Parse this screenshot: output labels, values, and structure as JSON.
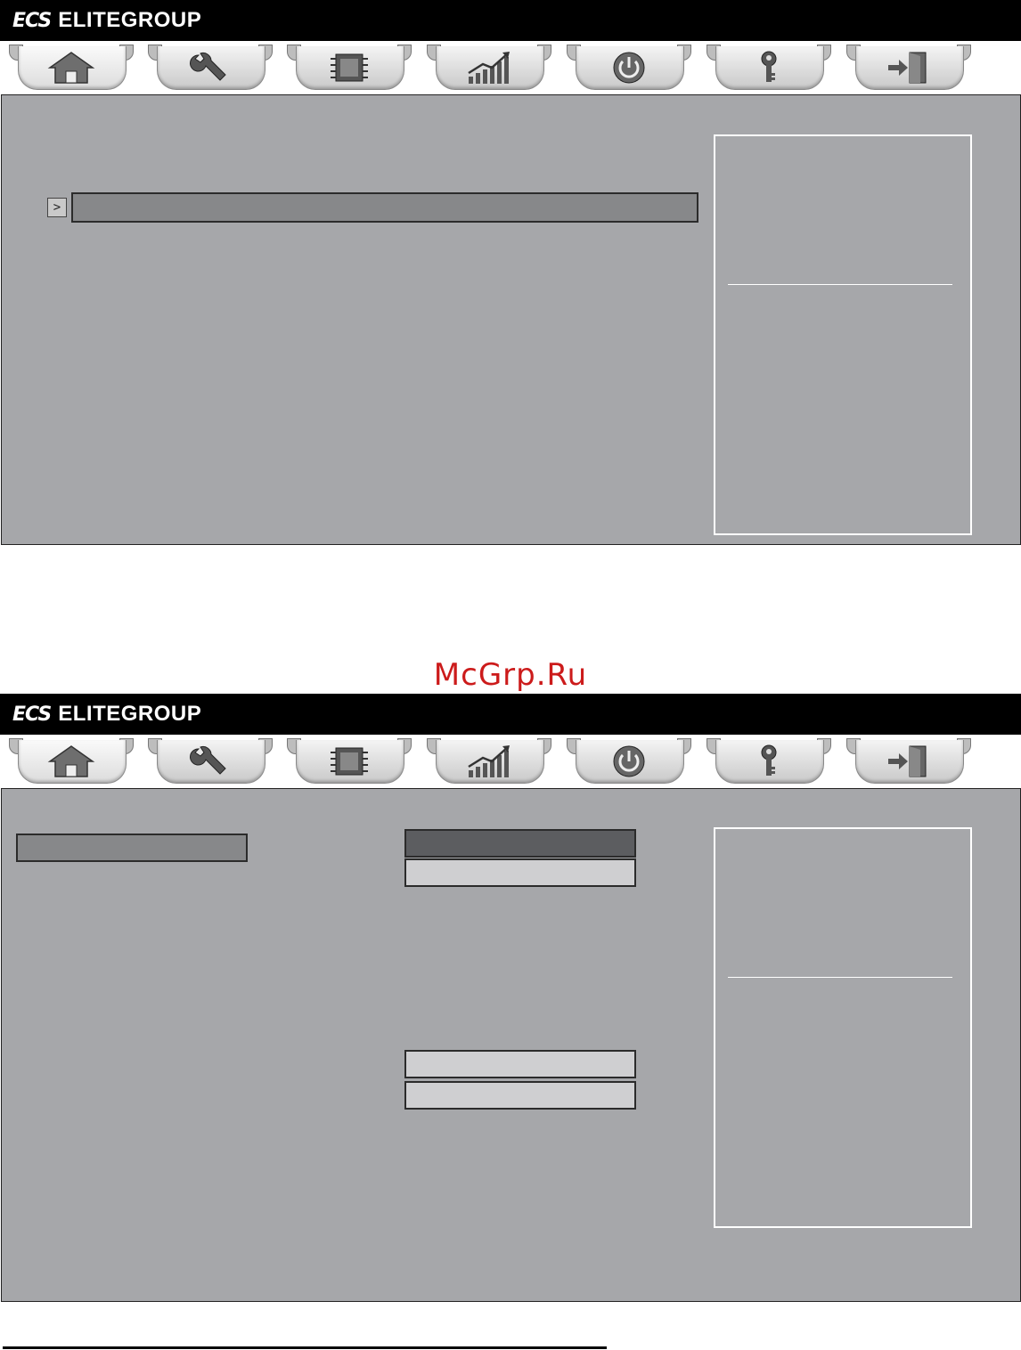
{
  "brand": {
    "logo": "ECS",
    "name": "ELITEGROUP"
  },
  "tabs": [
    {
      "icon": "home-icon"
    },
    {
      "icon": "wrench-icon"
    },
    {
      "icon": "chip-icon"
    },
    {
      "icon": "chart-icon"
    },
    {
      "icon": "power-icon"
    },
    {
      "icon": "key-icon"
    },
    {
      "icon": "exit-icon"
    }
  ],
  "screen1": {
    "submenu_arrow": ">"
  },
  "watermark": "McGrp.Ru",
  "colors": {
    "panel": "#a6a7aa",
    "selected_row": "#87888a",
    "field_dark": "#5c5d60",
    "field_light": "#cfcfd1",
    "watermark": "#cc1b1b"
  }
}
